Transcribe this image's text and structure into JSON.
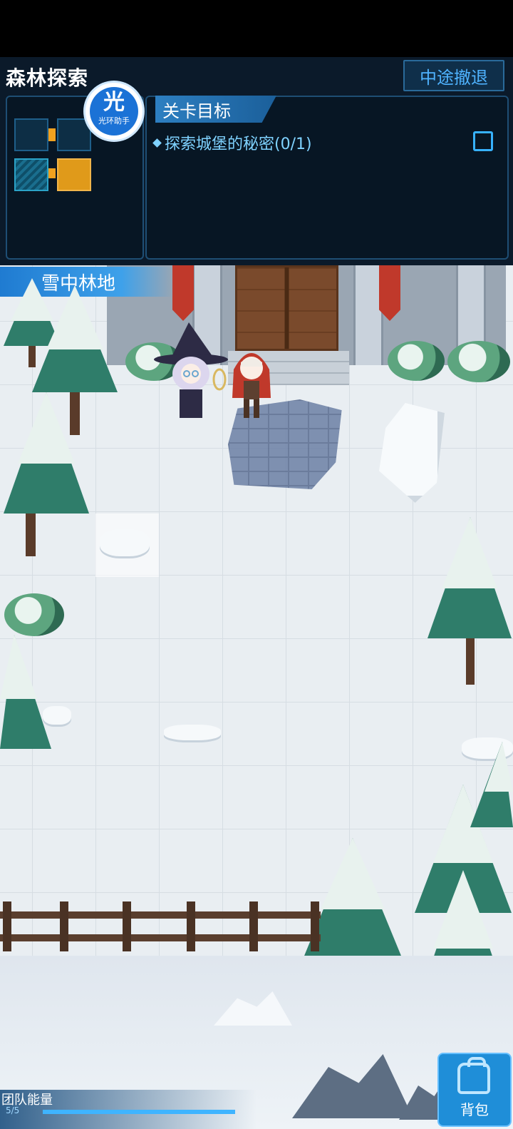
{
  "header": {
    "title": "森林探索",
    "retreat_label": "中途撤退"
  },
  "assistant": {
    "glyph": "光",
    "label": "光环助手"
  },
  "objectives": {
    "tab_label": "关卡目标",
    "items": [
      {
        "text": "探索城堡的秘密(0/1)",
        "completed": false
      }
    ]
  },
  "area": {
    "name": "雪中林地"
  },
  "bottom": {
    "energy_label": "团队能量",
    "energy_value": "5/5",
    "energy_fraction": 1.0,
    "bag_label": "背包"
  },
  "colors": {
    "hud_bg": "#0b1a2a",
    "accent": "#37b2ff",
    "snow": "#e9eef2",
    "pine": "#2f7d6a"
  }
}
